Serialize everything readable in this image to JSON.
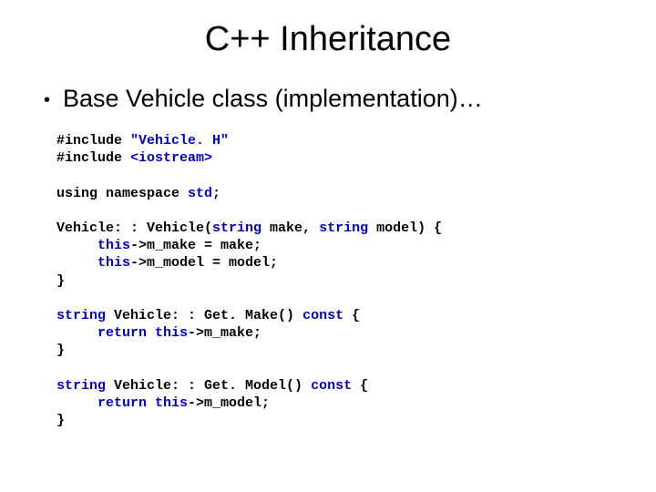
{
  "title": "C++ Inheritance",
  "bullet": "Base Vehicle class (implementation)…",
  "code": {
    "l1a": "#include ",
    "l1b": "\"Vehicle. H\"",
    "l2a": "#include ",
    "l2b": "<iostream>",
    "l3a": "using namespace ",
    "l3b": "std",
    "l3c": ";",
    "l4a": "Vehicle: : Vehicle(",
    "l4b": "string",
    "l4c": " make, ",
    "l4d": "string",
    "l4e": " model) {",
    "l5a": "     ",
    "l5b": "this",
    "l5c": "->m_make = make;",
    "l6a": "     ",
    "l6b": "this",
    "l6c": "->m_model = model;",
    "l7": "}",
    "l8a": "string",
    "l8b": " Vehicle: : Get. Make() ",
    "l8c": "const",
    "l8d": " {",
    "l9a": "     ",
    "l9b": "return this",
    "l9c": "->m_make;",
    "l10": "}",
    "l11a": "string",
    "l11b": " Vehicle: : Get. Model() ",
    "l11c": "const",
    "l11d": " {",
    "l12a": "     ",
    "l12b": "return this",
    "l12c": "->m_model;",
    "l13": "}"
  }
}
